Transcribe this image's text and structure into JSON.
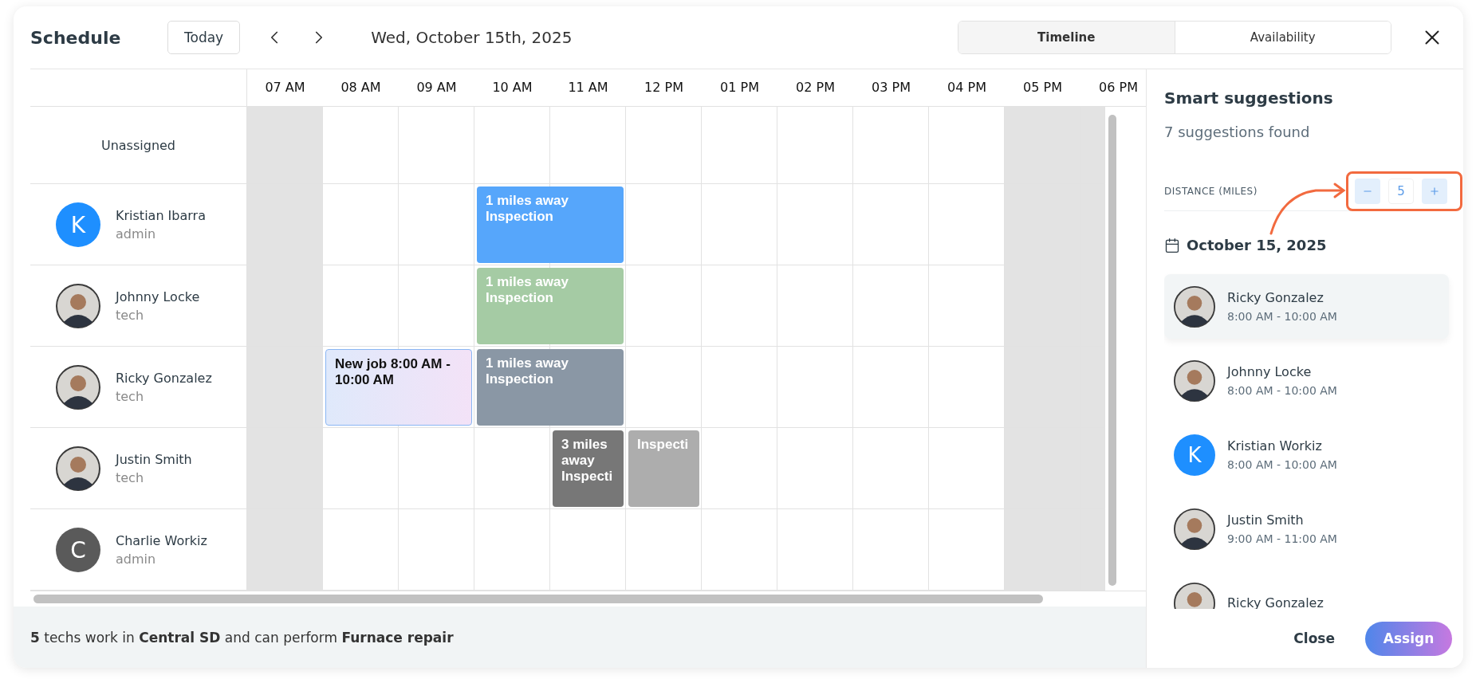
{
  "header": {
    "title": "Schedule",
    "today_button": "Today",
    "date": "Wed, October 15th, 2025",
    "view_tabs": [
      {
        "label": "Timeline",
        "selected": true
      },
      {
        "label": "Availability",
        "selected": false
      }
    ]
  },
  "hours": [
    {
      "label": "07 AM",
      "off": true
    },
    {
      "label": "08 AM",
      "off": false
    },
    {
      "label": "09 AM",
      "off": false
    },
    {
      "label": "10 AM",
      "off": false
    },
    {
      "label": "11 AM",
      "off": false
    },
    {
      "label": "12 PM",
      "off": false
    },
    {
      "label": "01 PM",
      "off": false
    },
    {
      "label": "02 PM",
      "off": false
    },
    {
      "label": "03 PM",
      "off": false
    },
    {
      "label": "04 PM",
      "off": false
    },
    {
      "label": "05 PM",
      "off": true
    },
    {
      "label": "06 PM",
      "off": true
    }
  ],
  "rows": [
    {
      "kind": "unassigned",
      "name": "Unassigned"
    },
    {
      "kind": "person",
      "name": "Kristian Ibarra",
      "role": "admin",
      "avatar": {
        "kind": "letter",
        "letter": "K",
        "color": "#1e8fff"
      },
      "jobs": [
        {
          "kind": "job",
          "text": [
            "1 miles away",
            "Inspection"
          ],
          "color": "#56a6fb"
        }
      ]
    },
    {
      "kind": "person",
      "name": "Johnny Locke",
      "role": "tech",
      "avatar": {
        "kind": "photo"
      },
      "jobs": [
        {
          "kind": "job",
          "text": [
            "1 miles away",
            "Inspection"
          ],
          "color": "#a5cba4"
        }
      ]
    },
    {
      "kind": "person",
      "name": "Ricky Gonzalez",
      "role": "tech",
      "avatar": {
        "kind": "photo"
      },
      "jobs": [
        {
          "kind": "new",
          "text": [
            "New job 8:00 AM -",
            "10:00 AM"
          ]
        },
        {
          "kind": "job",
          "text": [
            "1 miles away",
            "Inspection"
          ],
          "color": "#8a97a5"
        }
      ]
    },
    {
      "kind": "person",
      "name": "Justin Smith",
      "role": "tech",
      "avatar": {
        "kind": "photo"
      },
      "jobs": [
        {
          "kind": "job",
          "text": [
            "3 miles",
            "away",
            "Inspecti"
          ],
          "color": "#777777"
        },
        {
          "kind": "job",
          "text": [
            "Inspecti"
          ],
          "color": "#adadad"
        }
      ]
    },
    {
      "kind": "person",
      "name": "Charlie Workiz",
      "role": "admin",
      "avatar": {
        "kind": "letter",
        "letter": "C",
        "color": "#5a5a5a"
      }
    }
  ],
  "footer_note": "**5** techs work in **Central SD** and can perform **Furnace repair**",
  "suggestions_panel": {
    "title": "Smart suggestions",
    "count": "7 suggestions found",
    "distance": {
      "label": "DISTANCE (MILES)",
      "value": "5"
    },
    "date": "October 15, 2025",
    "items": [
      {
        "name": "Ricky Gonzalez",
        "time": "8:00 AM - 10:00 AM",
        "avatar": {
          "kind": "photo"
        },
        "selected": true
      },
      {
        "name": "Johnny Locke",
        "time": "8:00 AM - 10:00 AM",
        "avatar": {
          "kind": "photo"
        },
        "selected": false
      },
      {
        "name": "Kristian Workiz",
        "time": "8:00 AM - 10:00 AM",
        "avatar": {
          "kind": "letter",
          "letter": "K",
          "color": "#1e8fff"
        },
        "selected": false
      },
      {
        "name": "Justin Smith",
        "time": "9:00 AM - 11:00 AM",
        "avatar": {
          "kind": "photo"
        },
        "selected": false
      },
      {
        "name": "Ricky Gonzalez",
        "avatar": {
          "kind": "photo"
        },
        "selected": false
      }
    ],
    "actions": {
      "close": "Close",
      "assign": "Assign"
    }
  }
}
